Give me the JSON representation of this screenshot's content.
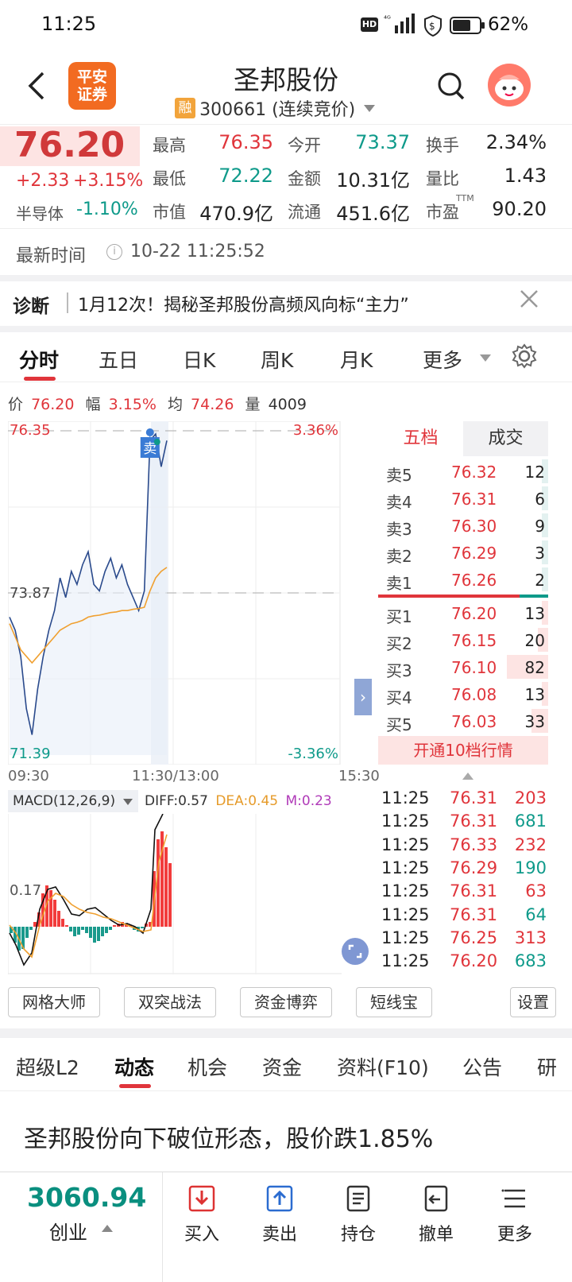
{
  "status_bar": {
    "time": "11:25",
    "battery": "62%"
  },
  "header": {
    "back_icon": "chevron-left-icon",
    "broker_logo": "平安\n证券",
    "title": "圣邦股份",
    "margin_badge": "融",
    "subtitle": "300661 (连续竞价)",
    "search_icon": "search-icon"
  },
  "quote": {
    "price": "76.20",
    "change": "+2.33",
    "change_pct": "+3.15%",
    "sector": "半导体",
    "sector_pct": "-1.10%",
    "fields": [
      {
        "label": "最高",
        "value": "76.35",
        "color": "red"
      },
      {
        "label": "今开",
        "value": "73.37",
        "color": "green"
      },
      {
        "label": "换手",
        "value": "2.34%",
        "color": "dark"
      },
      {
        "label": "最低",
        "value": "72.22",
        "color": "green"
      },
      {
        "label": "金额",
        "value": "10.31亿",
        "color": "dark"
      },
      {
        "label": "量比",
        "value": "1.43",
        "color": "dark"
      },
      {
        "label": "市值",
        "value": "470.9亿",
        "color": "dark"
      },
      {
        "label": "流通",
        "value": "451.6亿",
        "color": "dark"
      },
      {
        "label": "市盈",
        "value": "90.20",
        "color": "dark",
        "sup": "TTM"
      }
    ]
  },
  "latest_time": {
    "label": "最新时间",
    "value": "10-22 11:25:52"
  },
  "diagnosis": {
    "label": "诊断",
    "text": "1月12次！揭秘圣邦股份高频风向标“主力”"
  },
  "chart_tabs": [
    "分时",
    "五日",
    "日K",
    "周K",
    "月K",
    "更多"
  ],
  "chart_info": {
    "price_lbl": "价",
    "price": "76.20",
    "amp_lbl": "幅",
    "amp": "3.15%",
    "avg_lbl": "均",
    "avg": "74.26",
    "vol_lbl": "量",
    "vol": "4009"
  },
  "chart_data": {
    "type": "line",
    "ylim": [
      71.39,
      76.35
    ],
    "y_ticks": [
      "76.35",
      "73.87",
      "71.39"
    ],
    "pct_ticks": [
      "3.36%",
      "-3.36%"
    ],
    "x_ticks": [
      "09:30",
      "11:30/13:00",
      "15:30"
    ],
    "sell_marker": "卖",
    "series": [
      {
        "values": [
          73.5,
          73.3,
          72.9,
          72.1,
          71.7,
          72.4,
          72.9,
          73.3,
          73.6,
          74.1,
          73.8,
          74.2,
          74.0,
          74.3,
          74.5,
          74.0,
          73.9,
          74.2,
          74.4,
          74.1,
          74.3,
          74.0,
          73.8,
          73.6,
          73.9,
          76.2,
          76.3,
          75.8,
          76.2
        ]
      },
      {
        "values": [
          73.4,
          73.2,
          73.0,
          72.9,
          72.8,
          72.9,
          73.0,
          73.1,
          73.2,
          73.3,
          73.35,
          73.4,
          73.42,
          73.45,
          73.5,
          73.52,
          73.53,
          73.55,
          73.57,
          73.58,
          73.6,
          73.6,
          73.62,
          73.63,
          73.65,
          73.9,
          74.1,
          74.2,
          74.26
        ]
      }
    ]
  },
  "orderbook": {
    "tabs": [
      "五档",
      "成交"
    ],
    "asks": [
      {
        "label": "卖5",
        "price": "76.32",
        "vol": "12",
        "bar": 0.15
      },
      {
        "label": "卖4",
        "price": "76.31",
        "vol": "6",
        "bar": 0.07
      },
      {
        "label": "卖3",
        "price": "76.30",
        "vol": "9",
        "bar": 0.11
      },
      {
        "label": "卖2",
        "price": "76.29",
        "vol": "3",
        "bar": 0.04
      },
      {
        "label": "卖1",
        "price": "76.26",
        "vol": "2",
        "bar": 0.03
      }
    ],
    "bids": [
      {
        "label": "买1",
        "price": "76.20",
        "vol": "13",
        "bar": 0.16
      },
      {
        "label": "买2",
        "price": "76.15",
        "vol": "20",
        "bar": 0.25
      },
      {
        "label": "买3",
        "price": "76.10",
        "vol": "82",
        "bar": 1.0
      },
      {
        "label": "买4",
        "price": "76.08",
        "vol": "13",
        "bar": 0.16
      },
      {
        "label": "买5",
        "price": "76.03",
        "vol": "33",
        "bar": 0.4
      }
    ],
    "open10": "开通10档行情"
  },
  "macd": {
    "label": "MACD(12,26,9)",
    "diff": "DIFF:0.57",
    "dea": "DEA:0.45",
    "m": "M:0.23",
    "tick": "0.17"
  },
  "trades": [
    {
      "time": "11:25",
      "price": "76.31",
      "vol": "203",
      "side": "red"
    },
    {
      "time": "11:25",
      "price": "76.31",
      "vol": "681",
      "side": "green"
    },
    {
      "time": "11:25",
      "price": "76.33",
      "vol": "232",
      "side": "red"
    },
    {
      "time": "11:25",
      "price": "76.29",
      "vol": "190",
      "side": "green"
    },
    {
      "time": "11:25",
      "price": "76.31",
      "vol": "63",
      "side": "red"
    },
    {
      "time": "11:25",
      "price": "76.31",
      "vol": "64",
      "side": "green"
    },
    {
      "time": "11:25",
      "price": "76.25",
      "vol": "313",
      "side": "red"
    },
    {
      "time": "11:25",
      "price": "76.20",
      "vol": "683",
      "side": "green"
    }
  ],
  "tools": [
    "网格大师",
    "双突战法",
    "资金博弈",
    "短线宝",
    "设置"
  ],
  "info_tabs": [
    "超级L2",
    "动态",
    "机会",
    "资金",
    "资料(F10)",
    "公告",
    "研"
  ],
  "news": "圣邦股份向下破位形态，股价跌1.85%",
  "bottom": {
    "index_value": "3060.94",
    "index_name": "创业",
    "buttons": [
      {
        "label": "买入",
        "icon": "buy-icon"
      },
      {
        "label": "卖出",
        "icon": "sell-icon"
      },
      {
        "label": "持仓",
        "icon": "position-icon"
      },
      {
        "label": "撤单",
        "icon": "cancel-order-icon"
      },
      {
        "label": "更多",
        "icon": "more-menu-icon"
      }
    ]
  }
}
